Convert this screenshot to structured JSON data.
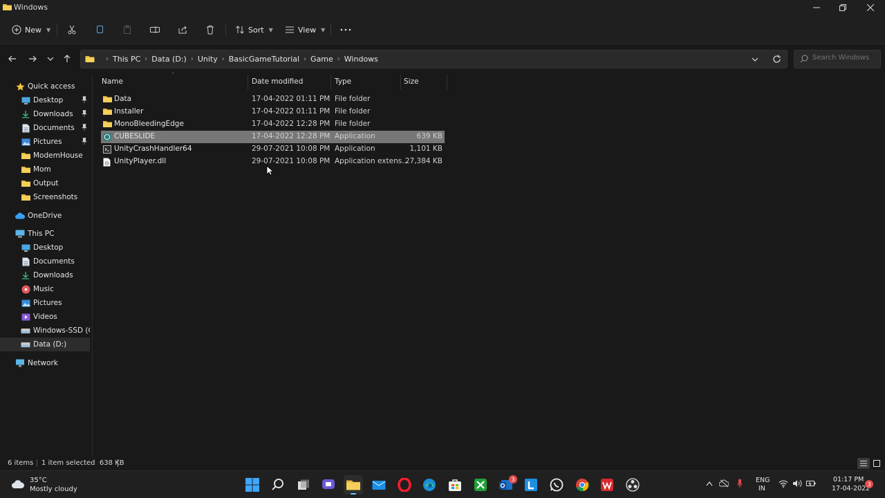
{
  "window": {
    "title": "Windows"
  },
  "toolbar": {
    "new_label": "New",
    "sort_label": "Sort",
    "view_label": "View"
  },
  "address": {
    "crumbs": [
      "This PC",
      "Data (D:)",
      "Unity",
      "BasicGameTutorial",
      "Game",
      "Windows"
    ],
    "search_placeholder": "Search Windows"
  },
  "sidebar": {
    "quick_access": "Quick access",
    "quick_items": [
      {
        "label": "Desktop",
        "icon": "desktop-icon",
        "pinned": true
      },
      {
        "label": "Downloads",
        "icon": "download-icon",
        "pinned": true
      },
      {
        "label": "Documents",
        "icon": "documents-icon",
        "pinned": true
      },
      {
        "label": "Pictures",
        "icon": "pictures-icon",
        "pinned": true
      },
      {
        "label": "ModemHouse",
        "icon": "folder-icon"
      },
      {
        "label": "Mom",
        "icon": "folder-icon"
      },
      {
        "label": "Output",
        "icon": "folder-icon"
      },
      {
        "label": "Screenshots",
        "icon": "folder-icon"
      }
    ],
    "onedrive": "OneDrive",
    "this_pc": "This PC",
    "pc_items": [
      {
        "label": "Desktop",
        "icon": "desktop-icon"
      },
      {
        "label": "Documents",
        "icon": "documents-icon"
      },
      {
        "label": "Downloads",
        "icon": "download-icon"
      },
      {
        "label": "Music",
        "icon": "music-icon"
      },
      {
        "label": "Pictures",
        "icon": "pictures-icon"
      },
      {
        "label": "Videos",
        "icon": "videos-icon"
      },
      {
        "label": "Windows-SSD (C:)",
        "icon": "drive-icon"
      },
      {
        "label": "Data (D:)",
        "icon": "drive-icon",
        "selected": true
      }
    ],
    "network": "Network"
  },
  "columns": {
    "name": "Name",
    "date": "Date modified",
    "type": "Type",
    "size": "Size"
  },
  "files": [
    {
      "name": "Data",
      "date": "17-04-2022 01:11 PM",
      "type": "File folder",
      "size": "",
      "icon": "folder-icon"
    },
    {
      "name": "Installer",
      "date": "17-04-2022 01:11 PM",
      "type": "File folder",
      "size": "",
      "icon": "folder-icon"
    },
    {
      "name": "MonoBleedingEdge",
      "date": "17-04-2022 12:28 PM",
      "type": "File folder",
      "size": "",
      "icon": "folder-icon"
    },
    {
      "name": "CUBESLIDE",
      "date": "17-04-2022 12:28 PM",
      "type": "Application",
      "size": "639 KB",
      "icon": "unity-app-icon",
      "selected": true
    },
    {
      "name": "UnityCrashHandler64",
      "date": "29-07-2021 10:08 PM",
      "type": "Application",
      "size": "1,101 KB",
      "icon": "application-icon"
    },
    {
      "name": "UnityPlayer.dll",
      "date": "29-07-2021 10:08 PM",
      "type": "Application extens...",
      "size": "27,384 KB",
      "icon": "dll-file-icon"
    }
  ],
  "status": {
    "count": "6 items",
    "selection": "1 item selected  638 KB"
  },
  "taskbar": {
    "weather_temp": "35°C",
    "weather_desc": "Mostly cloudy",
    "lang": "ENG",
    "region": "IN",
    "time": "01:17 PM",
    "date": "17-04-2022",
    "mail_badge": "3",
    "notif_badge": "3"
  },
  "colors": {
    "accent": "#60cdff",
    "folder": "#e8b93b",
    "selected_row": "#777777"
  }
}
